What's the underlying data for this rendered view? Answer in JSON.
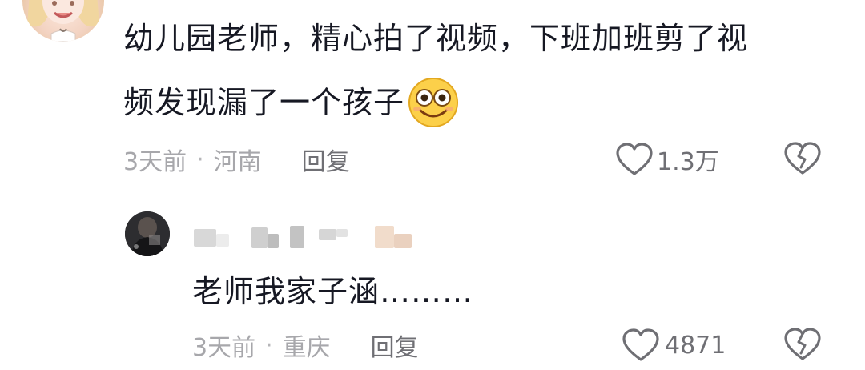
{
  "comment": {
    "text_line1": "幼儿园老师，精心拍了视频，下班加班剪了视",
    "text_line2": "频发现漏了一个孩子",
    "emoji": "emoji-smile",
    "time": "3天前",
    "separator": "·",
    "location": "河南",
    "reply_label": "回复",
    "like_count": "1.3万"
  },
  "reply": {
    "text": "老师我家子涵………",
    "time": "3天前",
    "separator": "·",
    "location": "重庆",
    "reply_label": "回复",
    "like_count": "4871"
  },
  "colors": {
    "text": "#161823",
    "meta": "#a7a7ab",
    "secondary": "#6f6f74"
  }
}
